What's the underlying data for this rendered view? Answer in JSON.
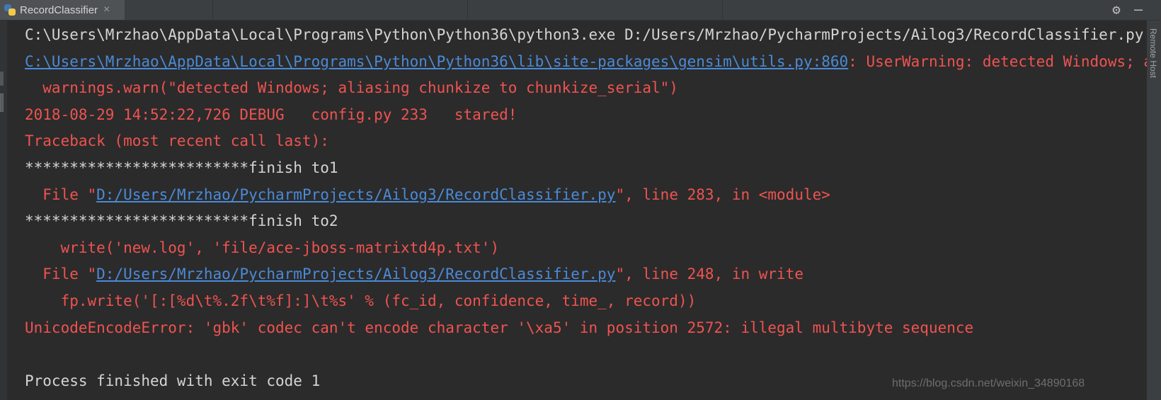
{
  "tab": {
    "title": "RecordClassifier",
    "close_glyph": "×"
  },
  "toolbar": {
    "gear_glyph": "⚙",
    "minimize_glyph": "—"
  },
  "side_label": "Remote Host",
  "console": {
    "line1": "C:\\Users\\Mrzhao\\AppData\\Local\\Programs\\Python\\Python36\\python3.exe D:/Users/Mrzhao/PycharmProjects/Ailog3/RecordClassifier.py",
    "line2_link": "C:\\Users\\Mrzhao\\AppData\\Local\\Programs\\Python\\Python36\\lib\\site-packages\\gensim\\utils.py:860",
    "line2_rest": ": UserWarning: detected Windows; aliasing chunkize to chunkize_serial",
    "line3": "  warnings.warn(\"detected Windows; aliasing chunkize to chunkize_serial\")",
    "line4": "2018-08-29 14:52:22,726 DEBUG   config.py 233   stared!",
    "line5": "Traceback (most recent call last):",
    "line6": "*************************finish to1",
    "line7_pre": "  File \"",
    "line7_link": "D:/Users/Mrzhao/PycharmProjects/Ailog3/RecordClassifier.py",
    "line7_post": "\", line 283, in <module>",
    "line8": "*************************finish to2",
    "line9": "    write('new.log', 'file/ace-jboss-matrixtd4p.txt')",
    "line10_pre": "  File \"",
    "line10_link": "D:/Users/Mrzhao/PycharmProjects/Ailog3/RecordClassifier.py",
    "line10_post": "\", line 248, in write",
    "line11": "    fp.write('[:[%d\\t%.2f\\t%f]:]\\t%s' % (fc_id, confidence, time_, record))",
    "line12": "UnicodeEncodeError: 'gbk' codec can't encode character '\\xa5' in position 2572: illegal multibyte sequence",
    "line13": "",
    "line14": "Process finished with exit code 1"
  },
  "watermark": "https://blog.csdn.net/weixin_34890168",
  "colors": {
    "background": "#2b2b2b",
    "error": "#ef5350",
    "link": "#4a8ad8",
    "text": "#d4d4d4"
  }
}
